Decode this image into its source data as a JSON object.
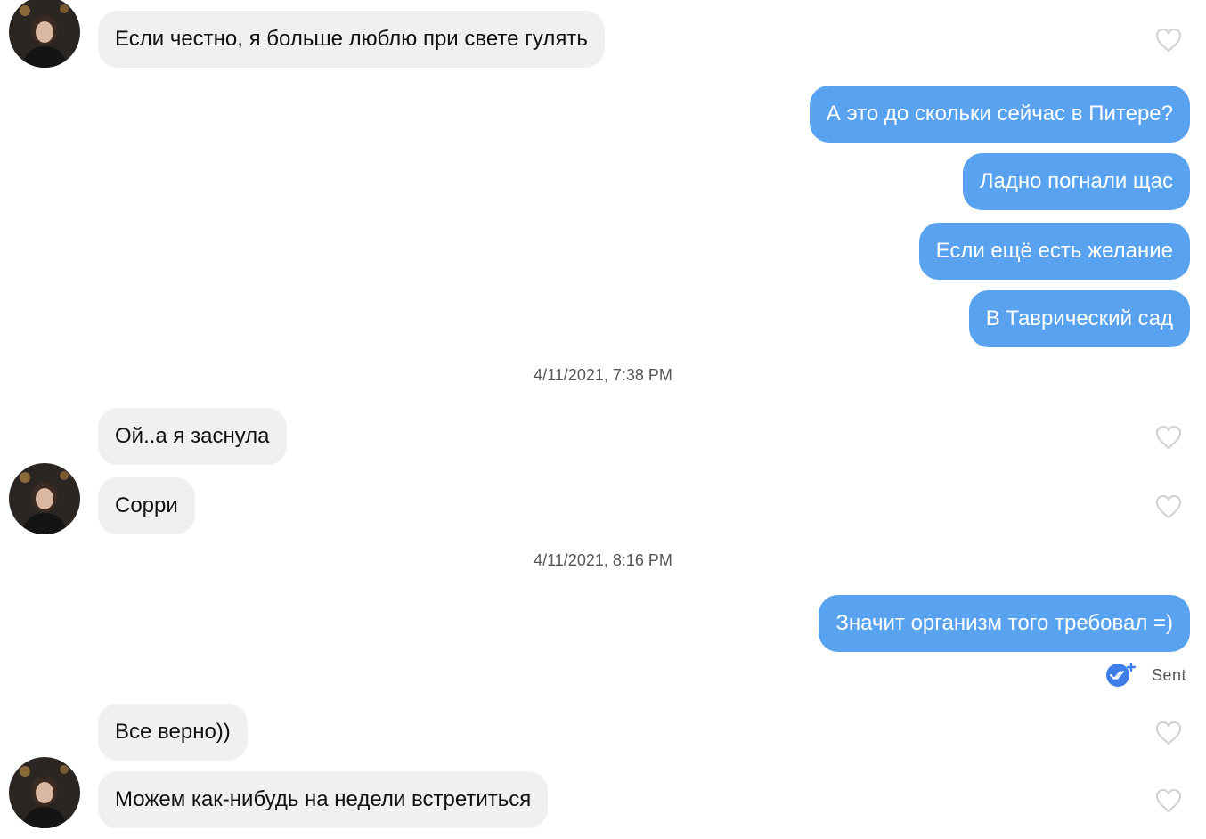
{
  "messages": [
    {
      "direction": "incoming",
      "text": "Если честно, я больше люблю при свете гулять"
    },
    {
      "direction": "outgoing",
      "text": "А это до скольки сейчас в Питере?"
    },
    {
      "direction": "outgoing",
      "text": "Ладно погнали щас"
    },
    {
      "direction": "outgoing",
      "text": "Если ещё есть желание"
    },
    {
      "direction": "outgoing",
      "text": "В Таврический сад"
    },
    {
      "direction": "incoming",
      "text": "Ой..а я заснула"
    },
    {
      "direction": "incoming",
      "text": "Сорри"
    },
    {
      "direction": "outgoing",
      "text": "Значит организм того требовал =)"
    },
    {
      "direction": "incoming",
      "text": "Все верно))"
    },
    {
      "direction": "incoming",
      "text": "Можем как-нибудь на недели встретиться"
    }
  ],
  "timestamps": [
    "4/11/2021, 7:38 PM",
    "4/11/2021, 8:16 PM"
  ],
  "status": {
    "label": "Sent"
  },
  "icons": {
    "like": "heart-outline-icon",
    "read_receipt": "double-check-plus-icon",
    "avatar": "contact-avatar"
  },
  "colors": {
    "outgoing_bubble": "#58a2f0",
    "incoming_bubble": "#f0f0f0",
    "heart_outline": "#d0d0d0",
    "receipt_badge": "#3f7ee8"
  }
}
